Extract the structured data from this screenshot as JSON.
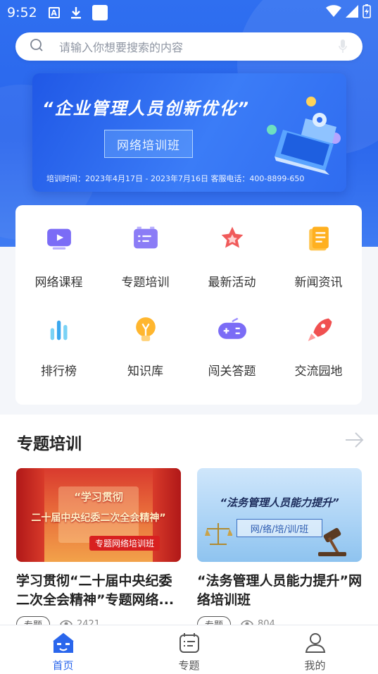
{
  "status_bar": {
    "time": "9:52",
    "icon_a": "A"
  },
  "search": {
    "placeholder": "请输入你想要搜索的内容"
  },
  "banner": {
    "title": "“企业管理人员创新优化”",
    "tag": "网络培训班",
    "info": "培训时间：2023年4月17日 - 2023年7月16日      客服电话：400-8899-650"
  },
  "grid": {
    "items": [
      {
        "label": "网络课程",
        "icon": "video-icon"
      },
      {
        "label": "专题培训",
        "icon": "list-board-icon"
      },
      {
        "label": "最新活动",
        "icon": "star-icon"
      },
      {
        "label": "新闻资讯",
        "icon": "news-icon"
      },
      {
        "label": "排行榜",
        "icon": "bar-chart-icon"
      },
      {
        "label": "知识库",
        "icon": "lightbulb-icon"
      },
      {
        "label": "闯关答题",
        "icon": "gamepad-icon"
      },
      {
        "label": "交流园地",
        "icon": "rocket-icon"
      }
    ]
  },
  "section": {
    "title": "专题培训",
    "courses": [
      {
        "image_line1": "“学习贯彻",
        "image_line2": "二十届中央纪委二次全会精神”",
        "image_badge": "专题网络培训班",
        "title": "学习贯彻“二十届中央纪委二次全会精神”专题网络...",
        "tag": "专题",
        "views": "2421"
      },
      {
        "image_line1": "“法务管理人员能力提升”",
        "image_line2": "网/络/培/训/班",
        "title": "“法务管理人员能力提升”网络培训班",
        "tag": "专题",
        "views": "804"
      }
    ]
  },
  "tabbar": {
    "tabs": [
      {
        "label": "首页",
        "active": true
      },
      {
        "label": "专题",
        "active": false
      },
      {
        "label": "我的",
        "active": false
      }
    ]
  },
  "colors": {
    "primary": "#2a66ec",
    "banner": "#2f6cf0",
    "accent_red": "#e84545"
  }
}
